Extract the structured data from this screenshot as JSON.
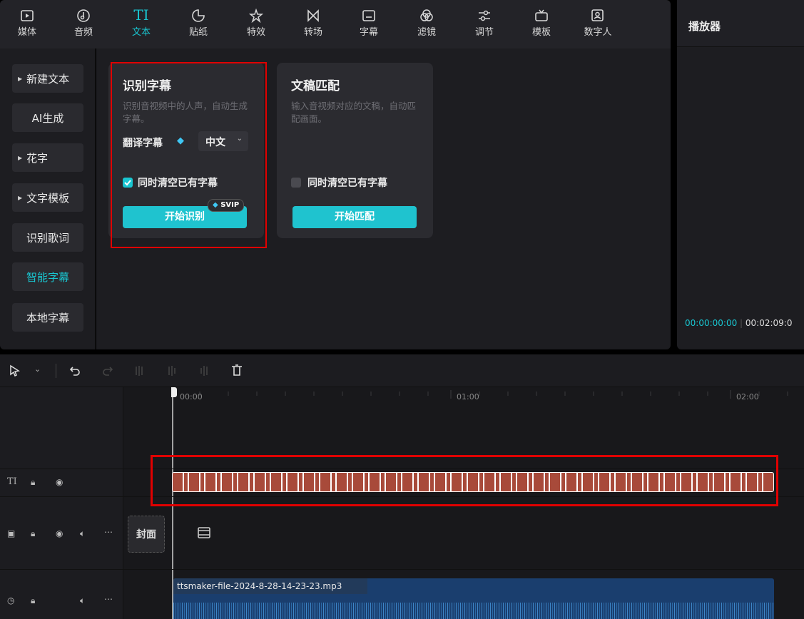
{
  "top_tabs": [
    {
      "label": "媒体",
      "icon": "media-icon"
    },
    {
      "label": "音频",
      "icon": "audio-icon"
    },
    {
      "label": "文本",
      "icon": "text-icon",
      "active": true
    },
    {
      "label": "贴纸",
      "icon": "sticker-icon"
    },
    {
      "label": "特效",
      "icon": "effects-icon"
    },
    {
      "label": "转场",
      "icon": "transition-icon"
    },
    {
      "label": "字幕",
      "icon": "subtitle-icon"
    },
    {
      "label": "滤镜",
      "icon": "filter-icon"
    },
    {
      "label": "调节",
      "icon": "adjust-icon"
    },
    {
      "label": "模板",
      "icon": "template-icon"
    },
    {
      "label": "数字人",
      "icon": "digital-human-icon"
    }
  ],
  "text_icon_glyph": "TI",
  "left_menu": [
    {
      "label": "新建文本",
      "arrow": true
    },
    {
      "label": "AI生成",
      "arrow": false
    },
    {
      "label": "花字",
      "arrow": true
    },
    {
      "label": "文字模板",
      "arrow": true
    },
    {
      "label": "识别歌词",
      "arrow": false
    },
    {
      "label": "智能字幕",
      "arrow": false,
      "active": true
    },
    {
      "label": "本地字幕",
      "arrow": false
    }
  ],
  "card_recognize": {
    "title": "识别字幕",
    "desc": "识别音视频中的人声，自动生成字幕。",
    "translate_label": "翻译字幕",
    "language": "中文",
    "clear_label": "同时清空已有字幕",
    "clear_checked": true,
    "button": "开始识别",
    "badge": "SVIP"
  },
  "card_match": {
    "title": "文稿匹配",
    "desc": "输入音视频对应的文稿，自动匹配画面。",
    "clear_label": "同时清空已有字幕",
    "clear_checked": false,
    "button": "开始匹配"
  },
  "player": {
    "title": "播放器",
    "time_current": "00:00:00:00",
    "time_total": "00:02:09:0"
  },
  "timeline": {
    "ticks": [
      "00:00",
      "01:00",
      "02:00"
    ],
    "cover_label": "封面",
    "audio_clip_name": "ttsmaker-file-2024-8-28-14-23-23.mp3"
  },
  "colors": {
    "accent": "#19c6d1",
    "highlight_box": "#e00000",
    "text_clip": "#a84a3a",
    "audio_clip": "#1a3e6e"
  }
}
